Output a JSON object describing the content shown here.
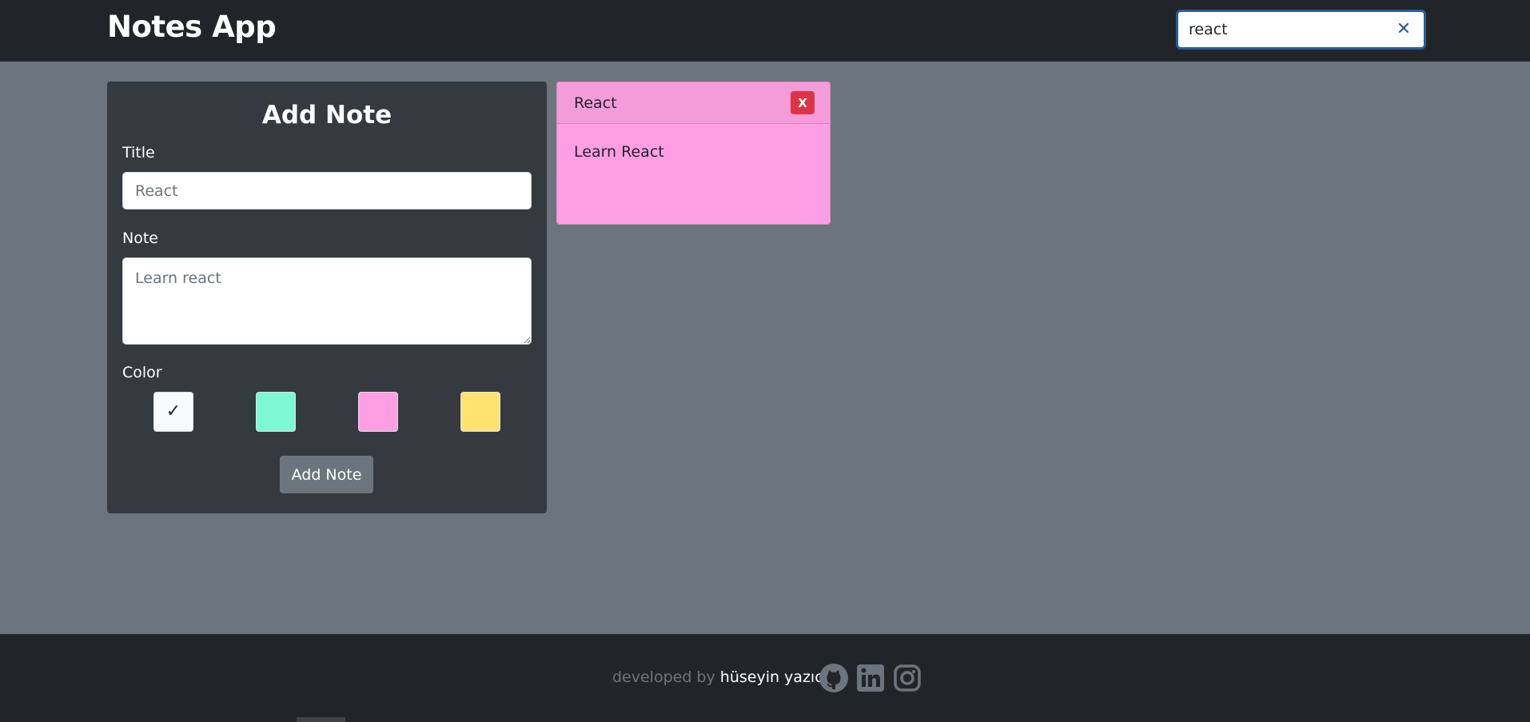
{
  "navbar": {
    "brand": "Notes App",
    "search": {
      "value": "react"
    }
  },
  "add_note": {
    "heading": "Add Note",
    "title_label": "Title",
    "title_placeholder": "React",
    "note_label": "Note",
    "note_placeholder": "Learn react",
    "color_label": "Color",
    "colors": [
      {
        "name": "white",
        "hex": "#f8f9fa",
        "selected": true
      },
      {
        "name": "mint",
        "hex": "#7df8d6",
        "selected": false
      },
      {
        "name": "pink",
        "hex": "#ff9ee3",
        "selected": false
      },
      {
        "name": "yellow",
        "hex": "#ffe270",
        "selected": false
      }
    ],
    "submit_label": "Add Note"
  },
  "notes": [
    {
      "title": "React",
      "body": "Learn React",
      "color": "#ff9ee3",
      "delete_label": "X"
    }
  ],
  "footer": {
    "prefix": "developed by ",
    "author": "hüseyin yazıcı",
    "social": [
      "github-icon",
      "linkedin-icon",
      "instagram-icon"
    ]
  }
}
